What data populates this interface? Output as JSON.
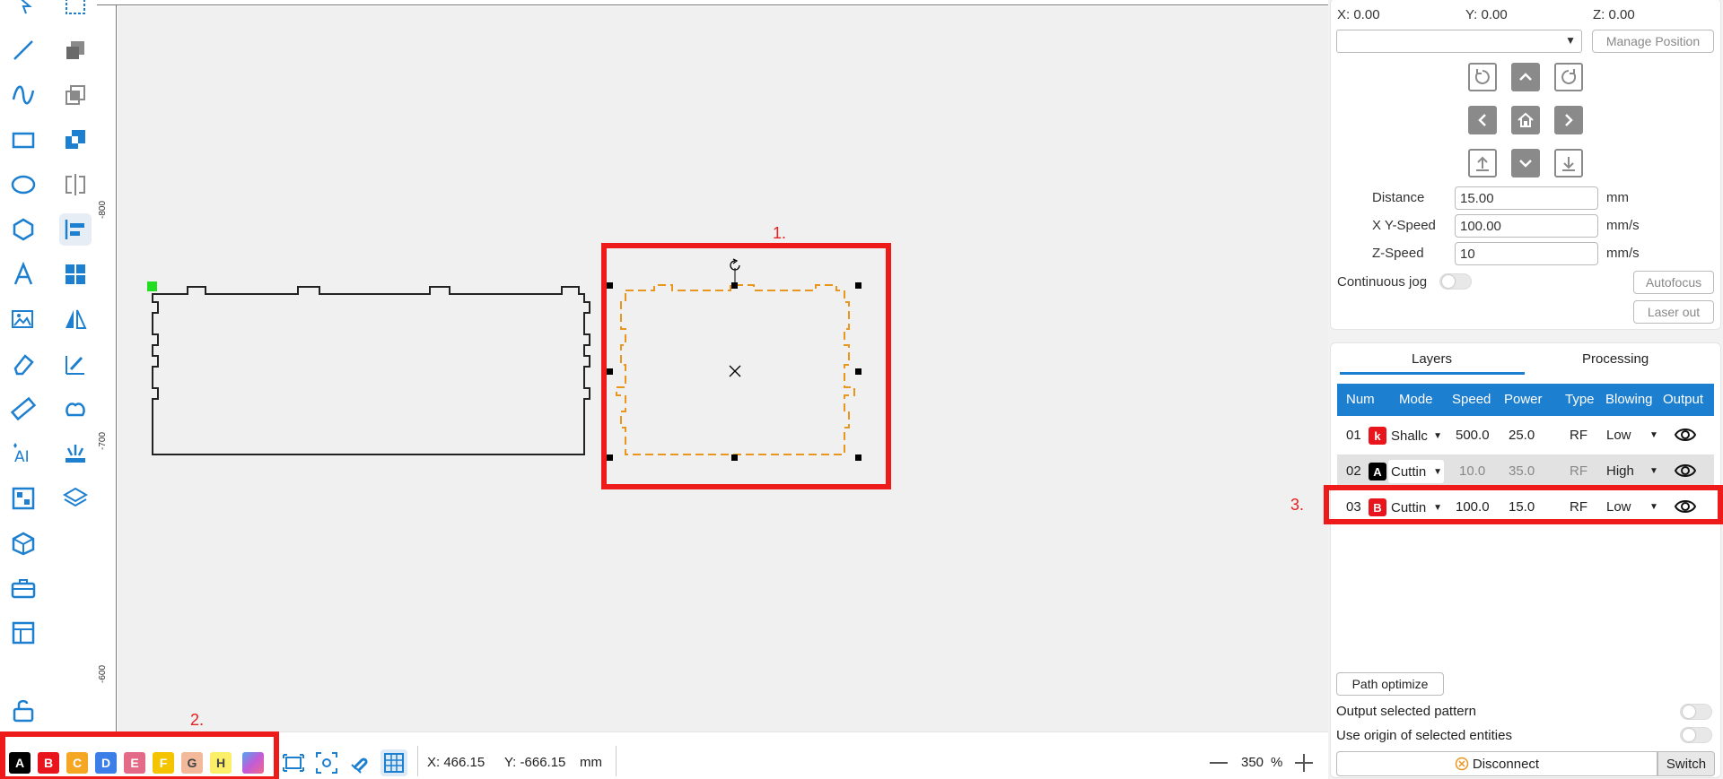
{
  "canvas": {
    "annotations": [
      "1.",
      "2.",
      "3."
    ],
    "ruler_labels": [
      "-800",
      "-700",
      "-600"
    ]
  },
  "bottom_bar": {
    "swatches": [
      {
        "letter": "A",
        "color": "#000000"
      },
      {
        "letter": "B",
        "color": "#e8161c"
      },
      {
        "letter": "C",
        "color": "#f5a623"
      },
      {
        "letter": "D",
        "color": "#3b7ee8"
      },
      {
        "letter": "E",
        "color": "#e36b87"
      },
      {
        "letter": "F",
        "color": "#f5c400"
      },
      {
        "letter": "G",
        "color": "#f2b99b"
      },
      {
        "letter": "H",
        "color": "#fbef6a"
      }
    ],
    "cursor_x": "X: 466.15",
    "cursor_y": "Y: -666.15",
    "cursor_unit": "mm",
    "zoom": "350",
    "zoom_unit": "%"
  },
  "position": {
    "x": "X:  0.00",
    "y": "Y:  0.00",
    "z": "Z:  0.00",
    "manage_label": "Manage Position"
  },
  "jog": {
    "distance_label": "Distance",
    "distance_value": "15.00",
    "distance_unit": "mm",
    "xy_speed_label": "X Y-Speed",
    "xy_speed_value": "100.00",
    "xy_speed_unit": "mm/s",
    "z_speed_label": "Z-Speed",
    "z_speed_value": "10",
    "z_speed_unit": "mm/s",
    "continuous_label": "Continuous jog",
    "autofocus_label": "Autofocus",
    "laser_out_label": "Laser out"
  },
  "tabs": {
    "layers": "Layers",
    "processing": "Processing"
  },
  "layer_table": {
    "headers": [
      "Num",
      "Mode",
      "Speed",
      "Power",
      "Type",
      "Blowing",
      "Output"
    ],
    "rows": [
      {
        "num": "01",
        "badge": "k",
        "badge_color": "#e8161c",
        "mode": "Shallc",
        "speed": "500.0",
        "power": "25.0",
        "type": "RF",
        "blowing": "Low"
      },
      {
        "num": "02",
        "badge": "A",
        "badge_color": "#000000",
        "mode": "Cuttin",
        "speed": "10.0",
        "power": "35.0",
        "type": "RF",
        "blowing": "High"
      },
      {
        "num": "03",
        "badge": "B",
        "badge_color": "#e8161c",
        "mode": "Cuttin",
        "speed": "100.0",
        "power": "15.0",
        "type": "RF",
        "blowing": "Low"
      }
    ]
  },
  "options": {
    "path_optimize": "Path optimize",
    "output_selected": "Output selected pattern",
    "use_origin": "Use origin of selected entities",
    "disconnect": "Disconnect",
    "switch": "Switch"
  }
}
